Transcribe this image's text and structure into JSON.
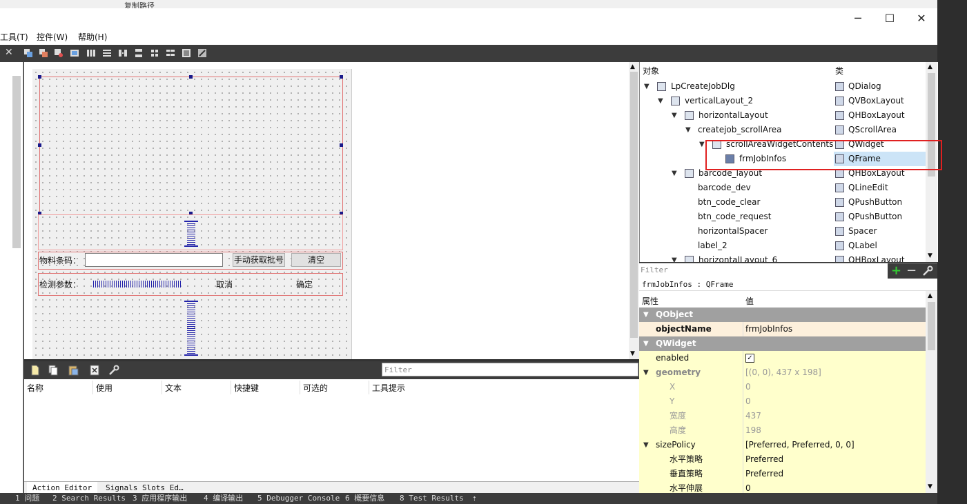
{
  "background_window": {
    "path_label": "复制路径"
  },
  "titlebar": {
    "minimize": "─",
    "maximize": "☐",
    "close": "✕"
  },
  "menubar": {
    "items": [
      "工具(T)",
      "控件(W)",
      "帮助(H)"
    ]
  },
  "form": {
    "material_label": "物料条码：",
    "fetch_button": "手动获取批号",
    "clear_button": "清空",
    "detect_label": "检测参数：",
    "cancel_label": "取消",
    "ok_label": "确定"
  },
  "action_editor": {
    "filter_placeholder": "Filter",
    "columns": [
      "名称",
      "使用",
      "文本",
      "快捷键",
      "可选的",
      "工具提示"
    ],
    "tabs": [
      "Action Editor",
      "Signals Slots Ed…"
    ]
  },
  "object_inspector": {
    "header_object": "对象",
    "header_class": "类",
    "rows": [
      {
        "name": "LpCreateJobDlg",
        "class": "QDialog"
      },
      {
        "name": "verticalLayout_2",
        "class": "QVBoxLayout"
      },
      {
        "name": "horizontalLayout",
        "class": "QHBoxLayout"
      },
      {
        "name": "createjob_scrollArea",
        "class": "QScrollArea"
      },
      {
        "name": "scrollAreaWidgetContents",
        "class": "QWidget"
      },
      {
        "name": "frmJobInfos",
        "class": "QFrame"
      },
      {
        "name": "barcode_layout",
        "class": "QHBoxLayout"
      },
      {
        "name": "barcode_dev",
        "class": "QLineEdit"
      },
      {
        "name": "btn_code_clear",
        "class": "QPushButton"
      },
      {
        "name": "btn_code_request",
        "class": "QPushButton"
      },
      {
        "name": "horizontalSpacer",
        "class": "Spacer"
      },
      {
        "name": "label_2",
        "class": "QLabel"
      },
      {
        "name": "horizontalLayout_6",
        "class": "QHBoxLayout"
      }
    ],
    "filter_placeholder": "Filter"
  },
  "property_editor": {
    "title": "frmJobInfos : QFrame",
    "header_property": "属性",
    "header_value": "值",
    "rows": [
      {
        "name": "QObject",
        "value": ""
      },
      {
        "name": "objectName",
        "value": "frmJobInfos"
      },
      {
        "name": "QWidget",
        "value": ""
      },
      {
        "name": "enabled",
        "value": ""
      },
      {
        "name": "geometry",
        "value": "[(0, 0), 437 x 198]"
      },
      {
        "name": "X",
        "value": "0"
      },
      {
        "name": "Y",
        "value": "0"
      },
      {
        "name": "宽度",
        "value": "437"
      },
      {
        "name": "高度",
        "value": "198"
      },
      {
        "name": "sizePolicy",
        "value": "[Preferred, Preferred, 0, 0]"
      },
      {
        "name": "水平策略",
        "value": "Preferred"
      },
      {
        "name": "垂直策略",
        "value": "Preferred"
      },
      {
        "name": "水平伸展",
        "value": "0"
      }
    ]
  },
  "statusbar": {
    "items": [
      "1 问题",
      "2 Search Results",
      "3 应用程序输出",
      "4 编译输出",
      "5 Debugger Console",
      "6 概要信息",
      "8 Test Results"
    ]
  },
  "colors": {
    "selection": "#cce4f7",
    "highlight_border": "#e02020",
    "group_header": "#a0a0a0"
  }
}
